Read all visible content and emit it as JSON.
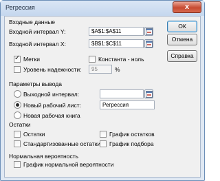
{
  "window": {
    "title": "Регрессия",
    "close_glyph": "x"
  },
  "input_group": {
    "title": "Входные данные",
    "y_label": "Входной интервал Y:",
    "y_value": "$A$1:$A$11",
    "x_label": "Входной интервал X:",
    "x_value": "$B$1:$C$11",
    "labels_checkbox": "Метки",
    "labels_checked": true,
    "constant_checkbox": "Константа - ноль",
    "constant_checked": false,
    "confidence_checkbox": "Уровень надежности:",
    "confidence_checked": false,
    "confidence_value": "95",
    "confidence_unit": "%"
  },
  "output_group": {
    "title": "Параметры вывода",
    "output_range_label": "Выходной интервал:",
    "output_range_value": "",
    "new_sheet_label": "Новый рабочий лист:",
    "new_sheet_value": "Регрессия",
    "new_workbook_label": "Новая рабочая книга",
    "selected": "new_sheet"
  },
  "residuals_group": {
    "title": "Остатки",
    "residuals": "Остатки",
    "standardized_residuals": "Стандартизованные остатки",
    "residual_plots": "График остатков",
    "line_fit_plots": "График подбора"
  },
  "normal_group": {
    "title": "Нормальная вероятность",
    "normal_plot": "График нормальной вероятности"
  },
  "buttons": {
    "ok": "ОК",
    "cancel": "Отмена",
    "help": "Справка"
  }
}
